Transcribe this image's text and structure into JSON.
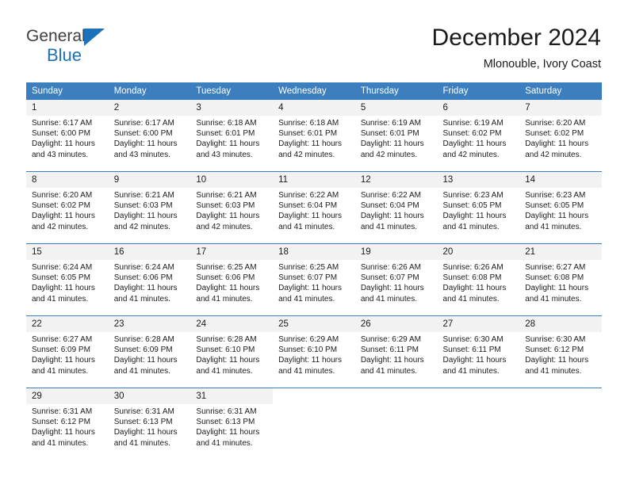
{
  "brand": {
    "name_part1": "General",
    "name_part2": "Blue",
    "logo_icon": "blue-triangle-icon",
    "colors": {
      "text": "#3f3f3f",
      "blue": "#1c71b8"
    }
  },
  "header": {
    "title": "December 2024",
    "subtitle": "Mlonouble, Ivory Coast"
  },
  "theme": {
    "header_blue": "#3d7ebf",
    "daynum_band": "#f2f2f2",
    "text": "#1a1a1a"
  },
  "calendar": {
    "weekday_headers": [
      "Sunday",
      "Monday",
      "Tuesday",
      "Wednesday",
      "Thursday",
      "Friday",
      "Saturday"
    ],
    "labels": {
      "sunrise": "Sunrise:",
      "sunset": "Sunset:",
      "daylight": "Daylight:"
    },
    "weeks": [
      [
        {
          "day": "1",
          "sunrise": "Sunrise: 6:17 AM",
          "sunset": "Sunset: 6:00 PM",
          "daylight_line1": "Daylight: 11 hours",
          "daylight_line2": "and 43 minutes."
        },
        {
          "day": "2",
          "sunrise": "Sunrise: 6:17 AM",
          "sunset": "Sunset: 6:00 PM",
          "daylight_line1": "Daylight: 11 hours",
          "daylight_line2": "and 43 minutes."
        },
        {
          "day": "3",
          "sunrise": "Sunrise: 6:18 AM",
          "sunset": "Sunset: 6:01 PM",
          "daylight_line1": "Daylight: 11 hours",
          "daylight_line2": "and 43 minutes."
        },
        {
          "day": "4",
          "sunrise": "Sunrise: 6:18 AM",
          "sunset": "Sunset: 6:01 PM",
          "daylight_line1": "Daylight: 11 hours",
          "daylight_line2": "and 42 minutes."
        },
        {
          "day": "5",
          "sunrise": "Sunrise: 6:19 AM",
          "sunset": "Sunset: 6:01 PM",
          "daylight_line1": "Daylight: 11 hours",
          "daylight_line2": "and 42 minutes."
        },
        {
          "day": "6",
          "sunrise": "Sunrise: 6:19 AM",
          "sunset": "Sunset: 6:02 PM",
          "daylight_line1": "Daylight: 11 hours",
          "daylight_line2": "and 42 minutes."
        },
        {
          "day": "7",
          "sunrise": "Sunrise: 6:20 AM",
          "sunset": "Sunset: 6:02 PM",
          "daylight_line1": "Daylight: 11 hours",
          "daylight_line2": "and 42 minutes."
        }
      ],
      [
        {
          "day": "8",
          "sunrise": "Sunrise: 6:20 AM",
          "sunset": "Sunset: 6:02 PM",
          "daylight_line1": "Daylight: 11 hours",
          "daylight_line2": "and 42 minutes."
        },
        {
          "day": "9",
          "sunrise": "Sunrise: 6:21 AM",
          "sunset": "Sunset: 6:03 PM",
          "daylight_line1": "Daylight: 11 hours",
          "daylight_line2": "and 42 minutes."
        },
        {
          "day": "10",
          "sunrise": "Sunrise: 6:21 AM",
          "sunset": "Sunset: 6:03 PM",
          "daylight_line1": "Daylight: 11 hours",
          "daylight_line2": "and 42 minutes."
        },
        {
          "day": "11",
          "sunrise": "Sunrise: 6:22 AM",
          "sunset": "Sunset: 6:04 PM",
          "daylight_line1": "Daylight: 11 hours",
          "daylight_line2": "and 41 minutes."
        },
        {
          "day": "12",
          "sunrise": "Sunrise: 6:22 AM",
          "sunset": "Sunset: 6:04 PM",
          "daylight_line1": "Daylight: 11 hours",
          "daylight_line2": "and 41 minutes."
        },
        {
          "day": "13",
          "sunrise": "Sunrise: 6:23 AM",
          "sunset": "Sunset: 6:05 PM",
          "daylight_line1": "Daylight: 11 hours",
          "daylight_line2": "and 41 minutes."
        },
        {
          "day": "14",
          "sunrise": "Sunrise: 6:23 AM",
          "sunset": "Sunset: 6:05 PM",
          "daylight_line1": "Daylight: 11 hours",
          "daylight_line2": "and 41 minutes."
        }
      ],
      [
        {
          "day": "15",
          "sunrise": "Sunrise: 6:24 AM",
          "sunset": "Sunset: 6:05 PM",
          "daylight_line1": "Daylight: 11 hours",
          "daylight_line2": "and 41 minutes."
        },
        {
          "day": "16",
          "sunrise": "Sunrise: 6:24 AM",
          "sunset": "Sunset: 6:06 PM",
          "daylight_line1": "Daylight: 11 hours",
          "daylight_line2": "and 41 minutes."
        },
        {
          "day": "17",
          "sunrise": "Sunrise: 6:25 AM",
          "sunset": "Sunset: 6:06 PM",
          "daylight_line1": "Daylight: 11 hours",
          "daylight_line2": "and 41 minutes."
        },
        {
          "day": "18",
          "sunrise": "Sunrise: 6:25 AM",
          "sunset": "Sunset: 6:07 PM",
          "daylight_line1": "Daylight: 11 hours",
          "daylight_line2": "and 41 minutes."
        },
        {
          "day": "19",
          "sunrise": "Sunrise: 6:26 AM",
          "sunset": "Sunset: 6:07 PM",
          "daylight_line1": "Daylight: 11 hours",
          "daylight_line2": "and 41 minutes."
        },
        {
          "day": "20",
          "sunrise": "Sunrise: 6:26 AM",
          "sunset": "Sunset: 6:08 PM",
          "daylight_line1": "Daylight: 11 hours",
          "daylight_line2": "and 41 minutes."
        },
        {
          "day": "21",
          "sunrise": "Sunrise: 6:27 AM",
          "sunset": "Sunset: 6:08 PM",
          "daylight_line1": "Daylight: 11 hours",
          "daylight_line2": "and 41 minutes."
        }
      ],
      [
        {
          "day": "22",
          "sunrise": "Sunrise: 6:27 AM",
          "sunset": "Sunset: 6:09 PM",
          "daylight_line1": "Daylight: 11 hours",
          "daylight_line2": "and 41 minutes."
        },
        {
          "day": "23",
          "sunrise": "Sunrise: 6:28 AM",
          "sunset": "Sunset: 6:09 PM",
          "daylight_line1": "Daylight: 11 hours",
          "daylight_line2": "and 41 minutes."
        },
        {
          "day": "24",
          "sunrise": "Sunrise: 6:28 AM",
          "sunset": "Sunset: 6:10 PM",
          "daylight_line1": "Daylight: 11 hours",
          "daylight_line2": "and 41 minutes."
        },
        {
          "day": "25",
          "sunrise": "Sunrise: 6:29 AM",
          "sunset": "Sunset: 6:10 PM",
          "daylight_line1": "Daylight: 11 hours",
          "daylight_line2": "and 41 minutes."
        },
        {
          "day": "26",
          "sunrise": "Sunrise: 6:29 AM",
          "sunset": "Sunset: 6:11 PM",
          "daylight_line1": "Daylight: 11 hours",
          "daylight_line2": "and 41 minutes."
        },
        {
          "day": "27",
          "sunrise": "Sunrise: 6:30 AM",
          "sunset": "Sunset: 6:11 PM",
          "daylight_line1": "Daylight: 11 hours",
          "daylight_line2": "and 41 minutes."
        },
        {
          "day": "28",
          "sunrise": "Sunrise: 6:30 AM",
          "sunset": "Sunset: 6:12 PM",
          "daylight_line1": "Daylight: 11 hours",
          "daylight_line2": "and 41 minutes."
        }
      ],
      [
        {
          "day": "29",
          "sunrise": "Sunrise: 6:31 AM",
          "sunset": "Sunset: 6:12 PM",
          "daylight_line1": "Daylight: 11 hours",
          "daylight_line2": "and 41 minutes."
        },
        {
          "day": "30",
          "sunrise": "Sunrise: 6:31 AM",
          "sunset": "Sunset: 6:13 PM",
          "daylight_line1": "Daylight: 11 hours",
          "daylight_line2": "and 41 minutes."
        },
        {
          "day": "31",
          "sunrise": "Sunrise: 6:31 AM",
          "sunset": "Sunset: 6:13 PM",
          "daylight_line1": "Daylight: 11 hours",
          "daylight_line2": "and 41 minutes."
        },
        {
          "day": "",
          "sunrise": "",
          "sunset": "",
          "daylight_line1": "",
          "daylight_line2": ""
        },
        {
          "day": "",
          "sunrise": "",
          "sunset": "",
          "daylight_line1": "",
          "daylight_line2": ""
        },
        {
          "day": "",
          "sunrise": "",
          "sunset": "",
          "daylight_line1": "",
          "daylight_line2": ""
        },
        {
          "day": "",
          "sunrise": "",
          "sunset": "",
          "daylight_line1": "",
          "daylight_line2": ""
        }
      ]
    ]
  }
}
